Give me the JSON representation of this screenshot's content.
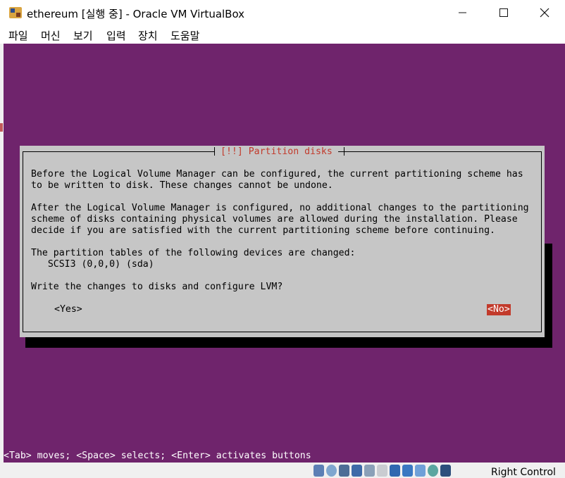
{
  "window": {
    "title": "ethereum [실행 중] - Oracle VM VirtualBox",
    "minimize_glyph": "─",
    "maximize_glyph": "☐",
    "close_glyph": "✕"
  },
  "menu": {
    "items": [
      "파일",
      "머신",
      "보기",
      "입력",
      "장치",
      "도움말"
    ]
  },
  "installer": {
    "background_color": "#6f246c",
    "dialog_title": "[!!] Partition disks",
    "lines": [
      "Before the Logical Volume Manager can be configured, the current partitioning scheme has",
      "to be written to disk. These changes cannot be undone.",
      "",
      "After the Logical Volume Manager is configured, no additional changes to the partitioning",
      "scheme of disks containing physical volumes are allowed during the installation. Please",
      "decide if you are satisfied with the current partitioning scheme before continuing.",
      "",
      "The partition tables of the following devices are changed:",
      "   SCSI3 (0,0,0) (sda)",
      "",
      "Write the changes to disks and configure LVM?"
    ],
    "yes_label": "<Yes>",
    "no_label": "<No>",
    "hint": "<Tab> moves; <Space> selects; <Enter> activates buttons"
  },
  "statusbar": {
    "host_key": "Right Control",
    "icons": [
      "hard-disk-icon",
      "optical-drive-icon",
      "audio-icon",
      "network-icon",
      "usb-icon",
      "shared-folders-icon",
      "display-icon",
      "video-capture-icon",
      "cpu-icon",
      "mouse-integration-icon",
      "keyboard-icon"
    ]
  }
}
